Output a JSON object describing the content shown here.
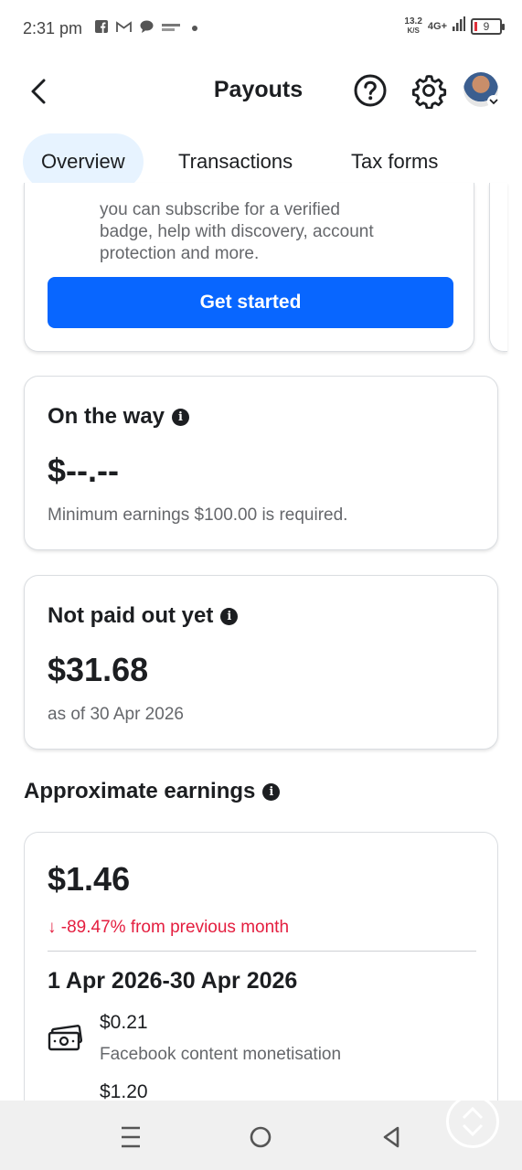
{
  "status_bar": {
    "time": "2:31 pm",
    "speed_value": "13.2",
    "speed_unit": "K/S",
    "network": "4G+",
    "battery": "9"
  },
  "header": {
    "title": "Payouts"
  },
  "tabs": [
    {
      "label": "Overview",
      "active": true
    },
    {
      "label": "Transactions",
      "active": false
    },
    {
      "label": "Tax forms",
      "active": false
    }
  ],
  "promo_card": {
    "text": "you can subscribe for a verified badge, help with discovery, account protection and more.",
    "button_label": "Get started"
  },
  "on_the_way": {
    "title": "On the way",
    "amount": "$--.--",
    "note": "Minimum earnings $100.00 is required."
  },
  "not_paid_out": {
    "title": "Not paid out yet",
    "amount": "$31.68",
    "note": "as of 30 Apr 2026"
  },
  "approx_earnings": {
    "section_title": "Approximate earnings",
    "amount": "$1.46",
    "change": "↓ -89.47% from previous month",
    "period": "1 Apr 2026-30 Apr 2026",
    "rows": [
      {
        "amount": "$0.21",
        "label": "Facebook content monetisation"
      },
      {
        "amount": "$1.20",
        "label": ""
      }
    ]
  },
  "colors": {
    "primary": "#0866ff",
    "tab_active_bg": "#e7f3ff",
    "negative": "#e41e3f",
    "secondary_text": "#65676b"
  },
  "icons": [
    "back-icon",
    "help-icon",
    "gear-icon",
    "info-icon",
    "cash-icon",
    "menu-icon",
    "home-icon",
    "nav-back-icon"
  ]
}
